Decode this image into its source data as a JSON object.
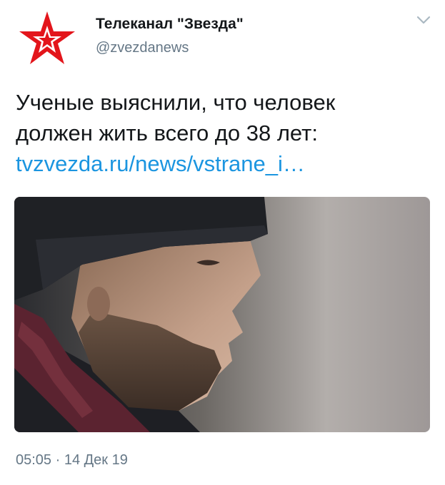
{
  "account": {
    "name": "Телеканал \"Звезда\"",
    "handle": "@zvezdanews",
    "avatar_icon": "zvezda-red-star-logo"
  },
  "header": {
    "menu_icon": "chevron-down-icon"
  },
  "tweet": {
    "text_line1": "Ученые выяснили, что человек",
    "text_line2": "должен жить всего до 38 лет:",
    "link": "tvzvezda.ru/news/vstrane_i…",
    "link_color": "#1b95e0"
  },
  "media": {
    "description_icon": "photo-bearded-man-in-beanie"
  },
  "footer": {
    "timestamp": "05:05 · 14 Дек 19"
  }
}
